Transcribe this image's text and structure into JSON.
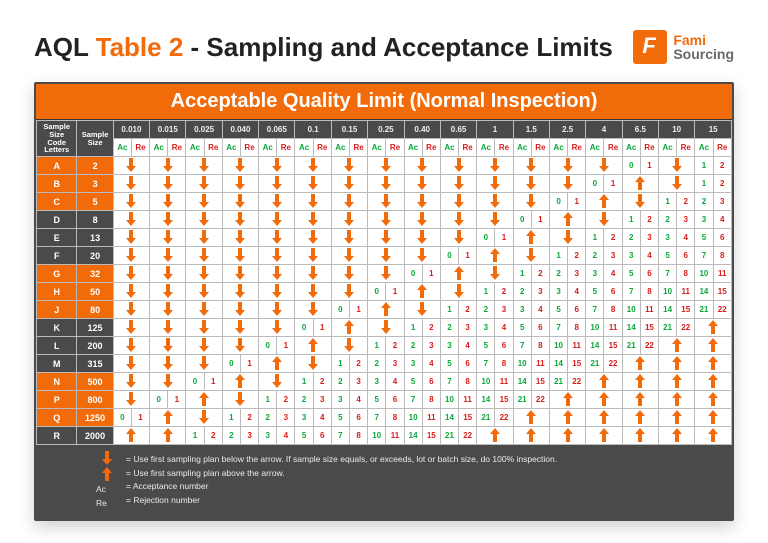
{
  "title_prefix": "AQL ",
  "title_orange": "Table 2",
  "title_suffix": " - Sampling and Acceptance Limits",
  "logo": {
    "brand_top": "Fami",
    "brand_bottom": "Sourcing"
  },
  "banner": "Acceptable Quality Limit (Normal Inspection)",
  "headers": {
    "letters": "Sample Size Code Letters",
    "size": "Sample Size",
    "ac": "Ac",
    "re": "Re"
  },
  "legend": {
    "down": "= Use first sampling plan below the arrow.  If sample size equals, or exceeds, lot or batch size, do 100% inspection.",
    "up": "= Use first sampling plan above the arrow.",
    "ac": "= Acceptance number",
    "re": "= Rejection number",
    "ac_label": "Ac",
    "re_label": "Re"
  },
  "chart_data": {
    "type": "table",
    "title": "AQL Table 2 – Sampling and Acceptance Limits (Normal Inspection)",
    "aql_levels": [
      "0.010",
      "0.015",
      "0.025",
      "0.040",
      "0.065",
      "0.1",
      "0.15",
      "0.25",
      "0.40",
      "0.65",
      "1",
      "1.5",
      "2.5",
      "4",
      "6.5",
      "10",
      "15"
    ],
    "rows": [
      {
        "letter": "A",
        "size": 2,
        "color": "orange",
        "cells": [
          "D",
          "D",
          "D",
          "D",
          "D",
          "D",
          "D",
          "D",
          "D",
          "D",
          "D",
          "D",
          "D",
          "D",
          [
            0,
            1
          ],
          "D",
          [
            1,
            2
          ]
        ]
      },
      {
        "letter": "B",
        "size": 3,
        "color": "orange",
        "cells": [
          "D",
          "D",
          "D",
          "D",
          "D",
          "D",
          "D",
          "D",
          "D",
          "D",
          "D",
          "D",
          "D",
          [
            0,
            1
          ],
          "U",
          "D",
          [
            1,
            2
          ]
        ]
      },
      {
        "letter": "C",
        "size": 5,
        "color": "orange",
        "cells": [
          "D",
          "D",
          "D",
          "D",
          "D",
          "D",
          "D",
          "D",
          "D",
          "D",
          "D",
          "D",
          [
            0,
            1
          ],
          "U",
          "D",
          [
            1,
            2
          ],
          [
            2,
            3
          ]
        ]
      },
      {
        "letter": "D",
        "size": 8,
        "color": "gray",
        "cells": [
          "D",
          "D",
          "D",
          "D",
          "D",
          "D",
          "D",
          "D",
          "D",
          "D",
          "D",
          [
            0,
            1
          ],
          "U",
          "D",
          [
            1,
            2
          ],
          [
            2,
            3
          ],
          [
            3,
            4
          ]
        ]
      },
      {
        "letter": "E",
        "size": 13,
        "color": "gray",
        "cells": [
          "D",
          "D",
          "D",
          "D",
          "D",
          "D",
          "D",
          "D",
          "D",
          "D",
          [
            0,
            1
          ],
          "U",
          "D",
          [
            1,
            2
          ],
          [
            2,
            3
          ],
          [
            3,
            4
          ],
          [
            5,
            6
          ]
        ]
      },
      {
        "letter": "F",
        "size": 20,
        "color": "gray",
        "cells": [
          "D",
          "D",
          "D",
          "D",
          "D",
          "D",
          "D",
          "D",
          "D",
          [
            0,
            1
          ],
          "U",
          "D",
          [
            1,
            2
          ],
          [
            2,
            3
          ],
          [
            3,
            4
          ],
          [
            5,
            6
          ],
          [
            7,
            8
          ]
        ]
      },
      {
        "letter": "G",
        "size": 32,
        "color": "orange",
        "cells": [
          "D",
          "D",
          "D",
          "D",
          "D",
          "D",
          "D",
          "D",
          [
            0,
            1
          ],
          "U",
          "D",
          [
            1,
            2
          ],
          [
            2,
            3
          ],
          [
            3,
            4
          ],
          [
            5,
            6
          ],
          [
            7,
            8
          ],
          [
            10,
            11
          ]
        ]
      },
      {
        "letter": "H",
        "size": 50,
        "color": "orange",
        "cells": [
          "D",
          "D",
          "D",
          "D",
          "D",
          "D",
          "D",
          [
            0,
            1
          ],
          "U",
          "D",
          [
            1,
            2
          ],
          [
            2,
            3
          ],
          [
            3,
            4
          ],
          [
            5,
            6
          ],
          [
            7,
            8
          ],
          [
            10,
            11
          ],
          [
            14,
            15
          ]
        ]
      },
      {
        "letter": "J",
        "size": 80,
        "color": "orange",
        "cells": [
          "D",
          "D",
          "D",
          "D",
          "D",
          "D",
          [
            0,
            1
          ],
          "U",
          "D",
          [
            1,
            2
          ],
          [
            2,
            3
          ],
          [
            3,
            4
          ],
          [
            5,
            6
          ],
          [
            7,
            8
          ],
          [
            10,
            11
          ],
          [
            14,
            15
          ],
          [
            21,
            22
          ]
        ]
      },
      {
        "letter": "K",
        "size": 125,
        "color": "gray",
        "cells": [
          "D",
          "D",
          "D",
          "D",
          "D",
          [
            0,
            1
          ],
          "U",
          "D",
          [
            1,
            2
          ],
          [
            2,
            3
          ],
          [
            3,
            4
          ],
          [
            5,
            6
          ],
          [
            7,
            8
          ],
          [
            10,
            11
          ],
          [
            14,
            15
          ],
          [
            21,
            22
          ],
          "U"
        ]
      },
      {
        "letter": "L",
        "size": 200,
        "color": "gray",
        "cells": [
          "D",
          "D",
          "D",
          "D",
          [
            0,
            1
          ],
          "U",
          "D",
          [
            1,
            2
          ],
          [
            2,
            3
          ],
          [
            3,
            4
          ],
          [
            5,
            6
          ],
          [
            7,
            8
          ],
          [
            10,
            11
          ],
          [
            14,
            15
          ],
          [
            21,
            22
          ],
          "U",
          "U"
        ]
      },
      {
        "letter": "M",
        "size": 315,
        "color": "gray",
        "cells": [
          "D",
          "D",
          "D",
          [
            0,
            1
          ],
          "U",
          "D",
          [
            1,
            2
          ],
          [
            2,
            3
          ],
          [
            3,
            4
          ],
          [
            5,
            6
          ],
          [
            7,
            8
          ],
          [
            10,
            11
          ],
          [
            14,
            15
          ],
          [
            21,
            22
          ],
          "U",
          "U",
          "U"
        ]
      },
      {
        "letter": "N",
        "size": 500,
        "color": "orange",
        "cells": [
          "D",
          "D",
          [
            0,
            1
          ],
          "U",
          "D",
          [
            1,
            2
          ],
          [
            2,
            3
          ],
          [
            3,
            4
          ],
          [
            5,
            6
          ],
          [
            7,
            8
          ],
          [
            10,
            11
          ],
          [
            14,
            15
          ],
          [
            21,
            22
          ],
          "U",
          "U",
          "U",
          "U"
        ]
      },
      {
        "letter": "P",
        "size": 800,
        "color": "orange",
        "cells": [
          "D",
          [
            0,
            1
          ],
          "U",
          "D",
          [
            1,
            2
          ],
          [
            2,
            3
          ],
          [
            3,
            4
          ],
          [
            5,
            6
          ],
          [
            7,
            8
          ],
          [
            10,
            11
          ],
          [
            14,
            15
          ],
          [
            21,
            22
          ],
          "U",
          "U",
          "U",
          "U",
          "U"
        ]
      },
      {
        "letter": "Q",
        "size": 1250,
        "color": "orange",
        "cells": [
          [
            0,
            1
          ],
          "U",
          "D",
          [
            1,
            2
          ],
          [
            2,
            3
          ],
          [
            3,
            4
          ],
          [
            5,
            6
          ],
          [
            7,
            8
          ],
          [
            10,
            11
          ],
          [
            14,
            15
          ],
          [
            21,
            22
          ],
          "U",
          "U",
          "U",
          "U",
          "U",
          "U"
        ]
      },
      {
        "letter": "R",
        "size": 2000,
        "color": "gray",
        "cells": [
          "U",
          "U",
          [
            1,
            2
          ],
          [
            2,
            3
          ],
          [
            3,
            4
          ],
          [
            5,
            6
          ],
          [
            7,
            8
          ],
          [
            10,
            11
          ],
          [
            14,
            15
          ],
          [
            21,
            22
          ],
          "U",
          "U",
          "U",
          "U",
          "U",
          "U",
          "U"
        ]
      }
    ]
  }
}
